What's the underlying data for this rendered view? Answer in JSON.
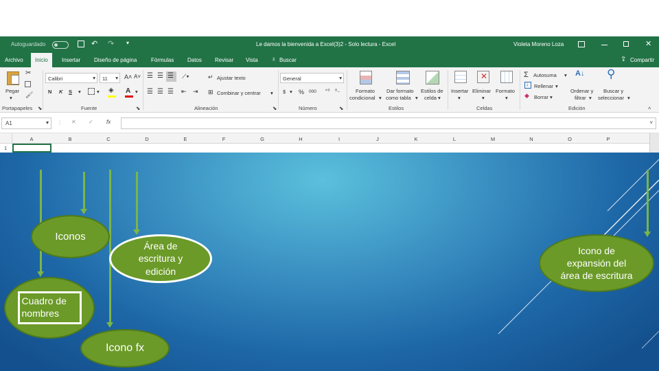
{
  "titlebar": {
    "autosave_label": "Autoguardado",
    "document_title": "Le damos la bienvenida a Excel(3)2  -  Solo lectura  -  Excel",
    "user_name": "Violeta Moreno Loza"
  },
  "tabs": {
    "archivo": "Archivo",
    "inicio": "Inicio",
    "insertar": "Insertar",
    "diseno": "Diseño de página",
    "formulas": "Fórmulas",
    "datos": "Datos",
    "revisar": "Revisar",
    "vista": "Vista",
    "buscar": "Buscar",
    "compartir": "Compartir"
  },
  "ribbon": {
    "pegar": "Pegar",
    "portapapeles": "Portapapeles",
    "font_name": "Calibri",
    "font_size": "11",
    "fuente": "Fuente",
    "ajustar_texto": "Ajustar texto",
    "combinar": "Combinar y centrar",
    "alineacion": "Alineación",
    "formato_numero": "General",
    "numero": "Número",
    "formato_condicional_1": "Formato",
    "formato_condicional_2": "condicional",
    "dar_formato_1": "Dar formato",
    "dar_formato_2": "como tabla",
    "estilos_celda_1": "Estilos de",
    "estilos_celda_2": "celda",
    "estilos": "Estilos",
    "insertar": "Insertar",
    "eliminar": "Eliminar",
    "formato": "Formato",
    "celdas": "Celdas",
    "autosuma": "Autosuma",
    "rellenar": "Rellenar",
    "borrar": "Borrar",
    "ordenar_1": "Ordenar y",
    "ordenar_2": "filtrar",
    "buscar_sel_1": "Buscar y",
    "buscar_sel_2": "seleccionar",
    "edicion": "Edición",
    "bold": "N",
    "italic": "K",
    "underline": "S",
    "currency": "$",
    "percent": "%",
    "thousands": "000"
  },
  "formula_bar": {
    "name_box": "A1",
    "fx": "fx"
  },
  "columns": [
    "A",
    "B",
    "C",
    "D",
    "E",
    "F",
    "G",
    "H",
    "I",
    "J",
    "K",
    "L",
    "M",
    "N",
    "O",
    "P"
  ],
  "row_number": "1",
  "callouts": {
    "iconos": "Iconos",
    "area": "Área de escritura y edición",
    "cuadro": "Cuadro de nombres",
    "fx": "Icono fx",
    "expansion": "Icono de expansión del área de escritura"
  },
  "colors": {
    "excel_green": "#217346",
    "callout_fill": "#6b9a28",
    "arrow": "#7ab648"
  }
}
